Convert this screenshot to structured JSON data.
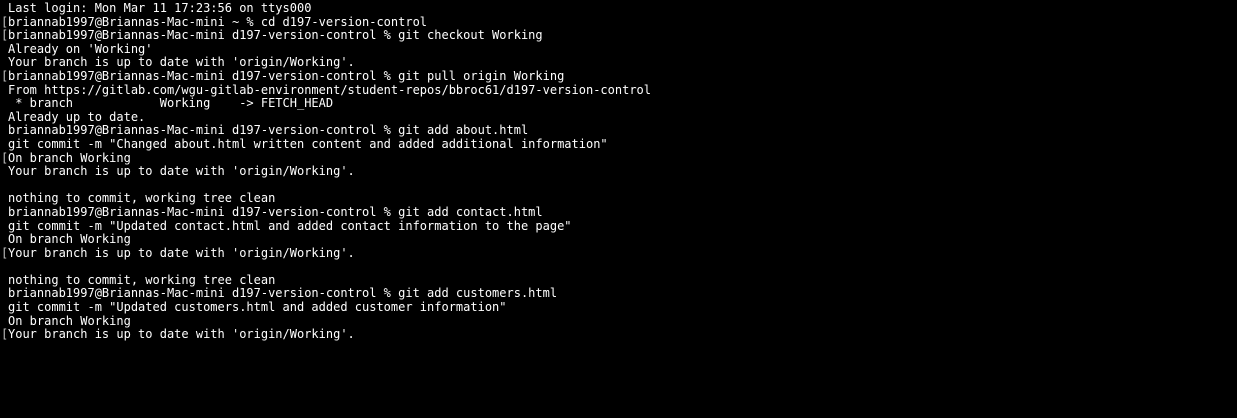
{
  "terminal": {
    "lines": [
      {
        "text": "Last login: Mon Mar 11 17:23:56 on ttys000",
        "marked": false
      },
      {
        "text": "briannab1997@Briannas-Mac-mini ~ % cd d197-version-control",
        "marked": true
      },
      {
        "text": "briannab1997@Briannas-Mac-mini d197-version-control % git checkout Working",
        "marked": true
      },
      {
        "text": "Already on 'Working'",
        "marked": false
      },
      {
        "text": "Your branch is up to date with 'origin/Working'.",
        "marked": false
      },
      {
        "text": "briannab1997@Briannas-Mac-mini d197-version-control % git pull origin Working",
        "marked": true
      },
      {
        "text": "From https://gitlab.com/wgu-gitlab-environment/student-repos/bbroc61/d197-version-control",
        "marked": false
      },
      {
        "text": " * branch            Working    -> FETCH_HEAD",
        "marked": false
      },
      {
        "text": "Already up to date.",
        "marked": false
      },
      {
        "text": "briannab1997@Briannas-Mac-mini d197-version-control % git add about.html",
        "marked": false
      },
      {
        "text": "git commit -m \"Changed about.html written content and added additional information\"",
        "marked": false
      },
      {
        "text": "On branch Working",
        "marked": true
      },
      {
        "text": "Your branch is up to date with 'origin/Working'.",
        "marked": false
      },
      {
        "text": "",
        "marked": false
      },
      {
        "text": "nothing to commit, working tree clean",
        "marked": false
      },
      {
        "text": "briannab1997@Briannas-Mac-mini d197-version-control % git add contact.html",
        "marked": false
      },
      {
        "text": "git commit -m \"Updated contact.html and added contact information to the page\"",
        "marked": false
      },
      {
        "text": "On branch Working",
        "marked": false
      },
      {
        "text": "Your branch is up to date with 'origin/Working'.",
        "marked": true
      },
      {
        "text": "",
        "marked": false
      },
      {
        "text": "nothing to commit, working tree clean",
        "marked": false
      },
      {
        "text": "briannab1997@Briannas-Mac-mini d197-version-control % git add customers.html",
        "marked": false
      },
      {
        "text": "git commit -m \"Updated customers.html and added customer information\"",
        "marked": false
      },
      {
        "text": "On branch Working",
        "marked": false
      },
      {
        "text": "Your branch is up to date with 'origin/Working'.",
        "marked": true
      }
    ]
  }
}
